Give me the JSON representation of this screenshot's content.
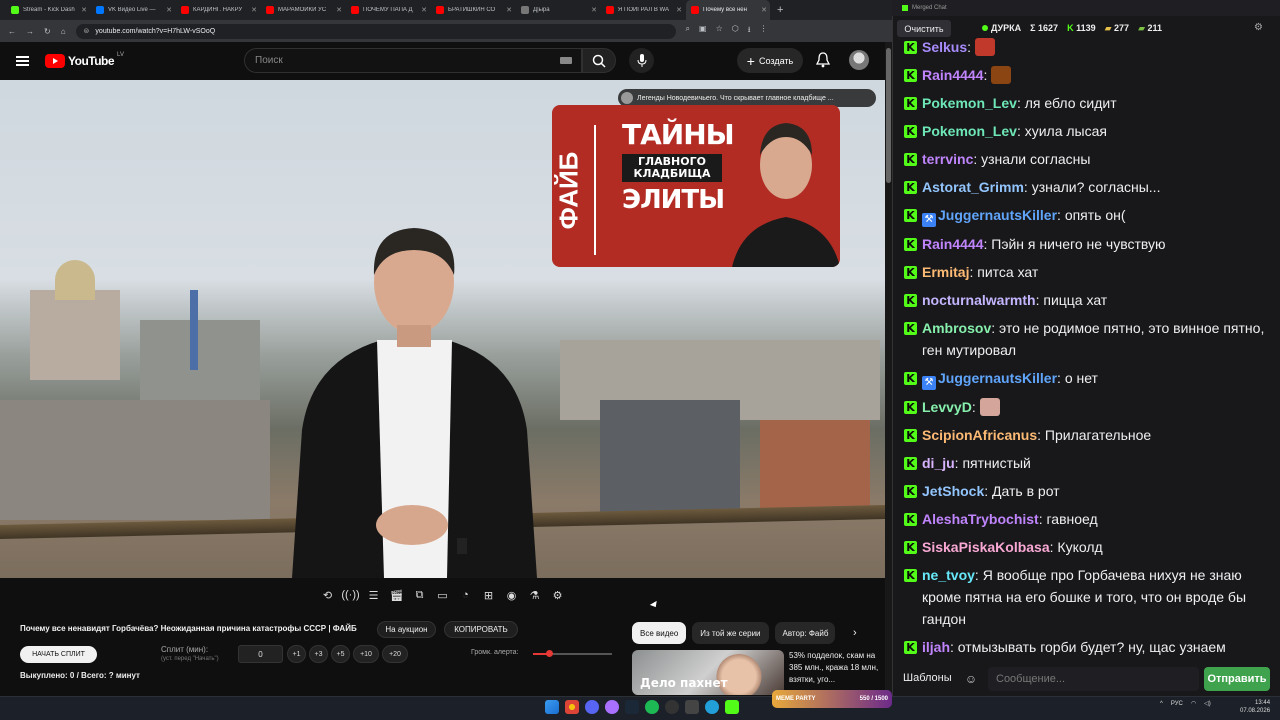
{
  "browser": {
    "tabs": [
      {
        "label": "Stream - Kick Dash",
        "color": "#53fc18"
      },
      {
        "label": "VK Видео Live — ",
        "color": "#0077ff"
      },
      {
        "label": "КАРДИНГ. НАКРУ",
        "color": "#ff0000"
      },
      {
        "label": "МАРАМОЙКИ УС",
        "color": "#ff0000"
      },
      {
        "label": "ПОЧЕМУ ПАПА Д",
        "color": "#ff0000"
      },
      {
        "label": "БРАТИШКИН СО",
        "color": "#ff0000"
      },
      {
        "label": "Д|ыра",
        "color": "#777777"
      },
      {
        "label": "Я ПОИГРАЛ В WA",
        "color": "#ff0000"
      },
      {
        "label": "Почему все нен",
        "color": "#ff0000"
      }
    ],
    "new_tab": "+",
    "url": "youtube.com/watch?v=H7hLW-vSOoQ"
  },
  "youtube": {
    "logo_word": "YouTube",
    "region": "LV",
    "search_placeholder": "Поиск",
    "create_label": "Создать",
    "endscreen_channel_title": "Легенды Новодевичьего. Что скрывает главное кладбище ...",
    "endcard": {
      "brand": "ФАЙБ",
      "line1": "ТАЙНЫ",
      "line2": "ГЛАВНОГО КЛАДБИЩА",
      "line3": "ЭЛИТЫ"
    },
    "video_title": "Почему все ненавидят Горбачёва? Неожиданная причина катастрофы СССР | ФАЙБ",
    "auction_label": "На аукцион",
    "copy_label": "КОПИРОВАТЬ",
    "start_split_label": "НАЧАТЬ СПЛИТ",
    "split_label": "Сплит (мин):",
    "split_sub": "(уст. перед \"Начать\")",
    "split_value": "0",
    "increments": [
      "+1",
      "+3",
      "+5",
      "+10",
      "+20"
    ],
    "alert_volume_label": "Громк. алерта:",
    "alert_volume": 0.2,
    "bought_text": "Выкуплено: 0 / Всего: ? минут",
    "chips": [
      "Все видео",
      "Из той же серии",
      "Автор: Файб"
    ],
    "rec_thumb_text": "Дело пахнет",
    "rec_title": "53% подделок, скам на 385 млн., кража 18 млн, взятки, уго..."
  },
  "chat": {
    "window_title": "Merged Chat",
    "clear_label": "Очистить",
    "streamer": "ДУРКА",
    "total": "Σ 1627",
    "kick_count": "1139",
    "count2": "277",
    "count3": "211",
    "messages": [
      {
        "user": "Selkus",
        "text": "",
        "color": "#a78bfa",
        "emote": "#c0392b"
      },
      {
        "user": "Rain4444",
        "text": "",
        "color": "#c084fc",
        "emote": "#8b4513"
      },
      {
        "user": "Pokemon_Lev",
        "text": "ля ебло сидит",
        "color": "#6ee7b7"
      },
      {
        "user": "Pokemon_Lev",
        "text": "хуила лысая",
        "color": "#6ee7b7"
      },
      {
        "user": "terrvinc",
        "text": "узнали согласны",
        "color": "#c084fc"
      },
      {
        "user": "Astorat_Grimm",
        "text": "узнали? согласны...",
        "color": "#93c5fd"
      },
      {
        "user": "JuggernautsKiller",
        "text": "опять он(",
        "color": "#60a5fa",
        "badge": "⚒"
      },
      {
        "user": "Rain4444",
        "text": "Пэйн я ничего не чувствую",
        "color": "#c084fc"
      },
      {
        "user": "Ermitaj",
        "text": "питса хат",
        "color": "#fdba74"
      },
      {
        "user": "nocturnalwarmth",
        "text": "пицца хат",
        "color": "#c4b5fd"
      },
      {
        "user": "Ambrosov",
        "text": "это не родимое пятно, это винное пятно, ген мутировал",
        "color": "#86efac"
      },
      {
        "user": "JuggernautsKiller",
        "text": "о нет",
        "color": "#60a5fa",
        "badge": "⚒"
      },
      {
        "user": "LevvyD",
        "text": "",
        "color": "#86efac",
        "emote": "#d4a59a"
      },
      {
        "user": "ScipionAfricanus",
        "text": "Прилагательное",
        "color": "#fdba74"
      },
      {
        "user": "di_ju",
        "text": "пятнистый",
        "color": "#d8b4fe"
      },
      {
        "user": "JetShock",
        "text": "Дать в рот",
        "color": "#93c5fd"
      },
      {
        "user": "AleshaTrybochist",
        "text": "гавноед",
        "color": "#c084fc"
      },
      {
        "user": "SiskaPiskaKolbasa",
        "text": "Куколд",
        "color": "#f9a8d4"
      },
      {
        "user": "ne_tvoy",
        "text": "Я вообще про Горбачева нихуя не знаю кроме пятна на его бошке и того, что он вроде бы гандон",
        "color": "#67e8f9"
      },
      {
        "user": "iljah",
        "text": "отмызывать горби будет? ну, щас узнаем",
        "color": "#c084fc"
      }
    ],
    "templates_label": "Шаблоны",
    "message_placeholder": "Сообщение...",
    "send_label": "Отправить"
  },
  "taskbar": {
    "meme_label": "MEME PARTY",
    "meme_value": "550 / 1500",
    "lang": "РУС",
    "time": "13:44",
    "date": "07.08.2026"
  }
}
